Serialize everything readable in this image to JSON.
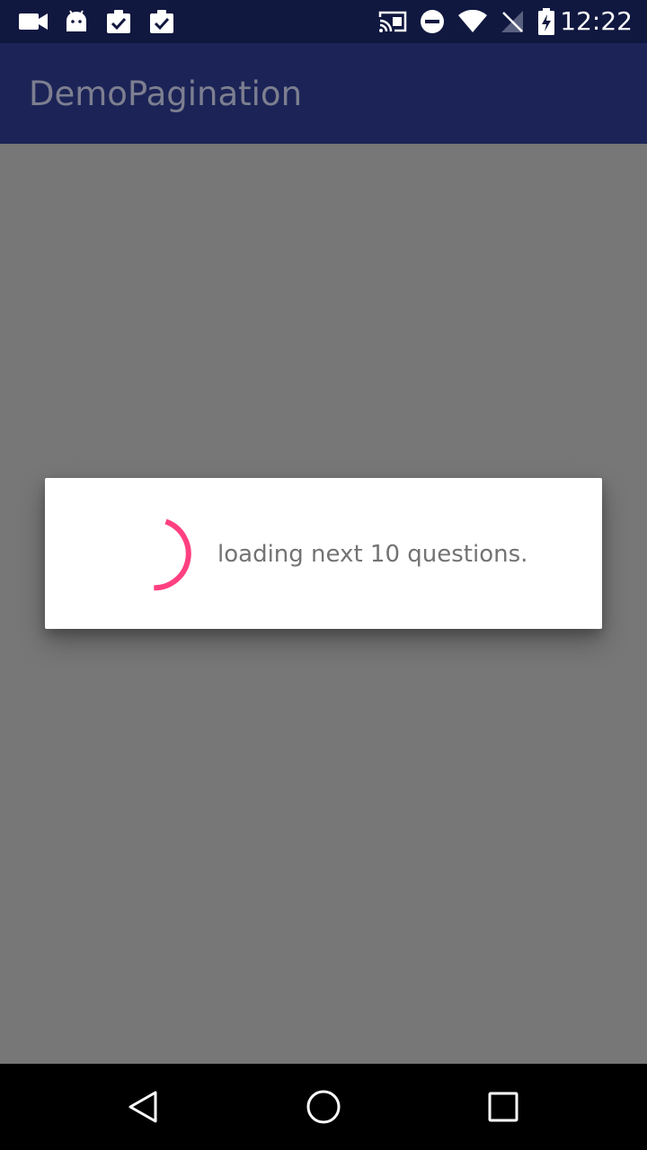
{
  "status_bar": {
    "time": "12:22",
    "left_icons": [
      "video-camera-icon",
      "android-icon",
      "clipboard-check-icon",
      "clipboard-check-icon"
    ],
    "right_icons": [
      "cast-icon",
      "do-not-disturb-icon",
      "wifi-icon",
      "no-signal-icon",
      "battery-charging-icon"
    ]
  },
  "app_bar": {
    "title": "DemoPagination"
  },
  "dialog": {
    "message": "loading next 10 questions.",
    "spinner_color": "#ff4081"
  },
  "nav_bar": {
    "buttons": [
      "back-icon",
      "home-icon",
      "recents-icon"
    ]
  },
  "colors": {
    "status_bar": "#101840",
    "app_bar": "#1c2457",
    "scrim": "#777777",
    "dialog_bg": "#ffffff",
    "accent": "#ff4081"
  }
}
